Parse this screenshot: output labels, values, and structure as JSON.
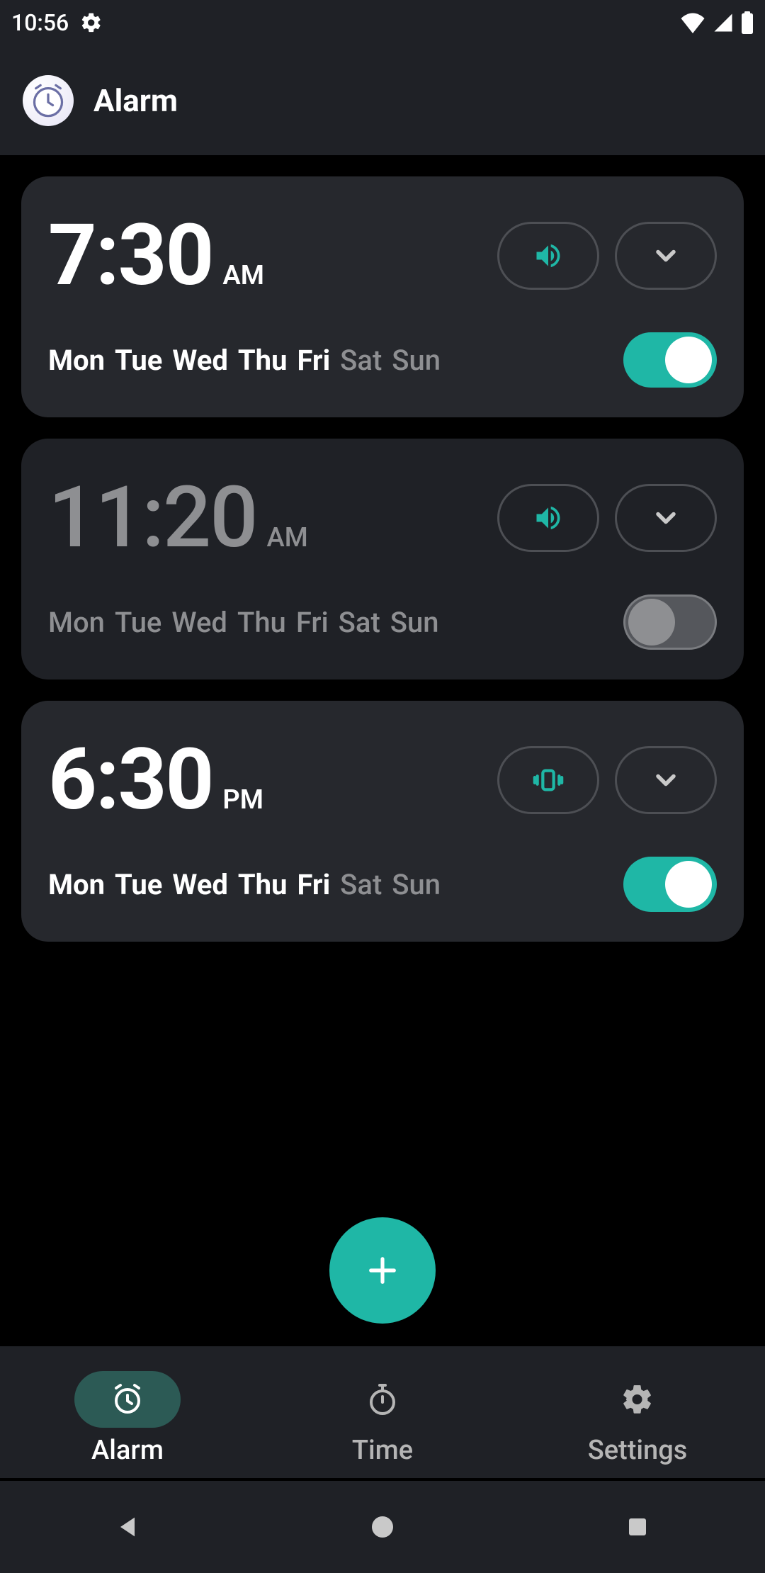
{
  "status": {
    "time": "10:56"
  },
  "header": {
    "title": "Alarm"
  },
  "days": [
    "Mon",
    "Tue",
    "Wed",
    "Thu",
    "Fri",
    "Sat",
    "Sun"
  ],
  "alarms": [
    {
      "time": "7:30",
      "ampm": "AM",
      "enabled": true,
      "mode": "sound",
      "active_days": [
        true,
        true,
        true,
        true,
        true,
        false,
        false
      ]
    },
    {
      "time": "11:20",
      "ampm": "AM",
      "enabled": false,
      "mode": "sound",
      "active_days": [
        true,
        true,
        true,
        true,
        true,
        true,
        true
      ]
    },
    {
      "time": "6:30",
      "ampm": "PM",
      "enabled": true,
      "mode": "vibrate",
      "active_days": [
        true,
        true,
        true,
        true,
        true,
        false,
        false
      ]
    }
  ],
  "nav": {
    "items": [
      {
        "label": "Alarm",
        "icon": "alarm-icon",
        "active": true
      },
      {
        "label": "Time",
        "icon": "stopwatch-icon",
        "active": false
      },
      {
        "label": "Settings",
        "icon": "gear-icon",
        "active": false
      }
    ]
  },
  "colors": {
    "accent": "#1fb7a6"
  }
}
